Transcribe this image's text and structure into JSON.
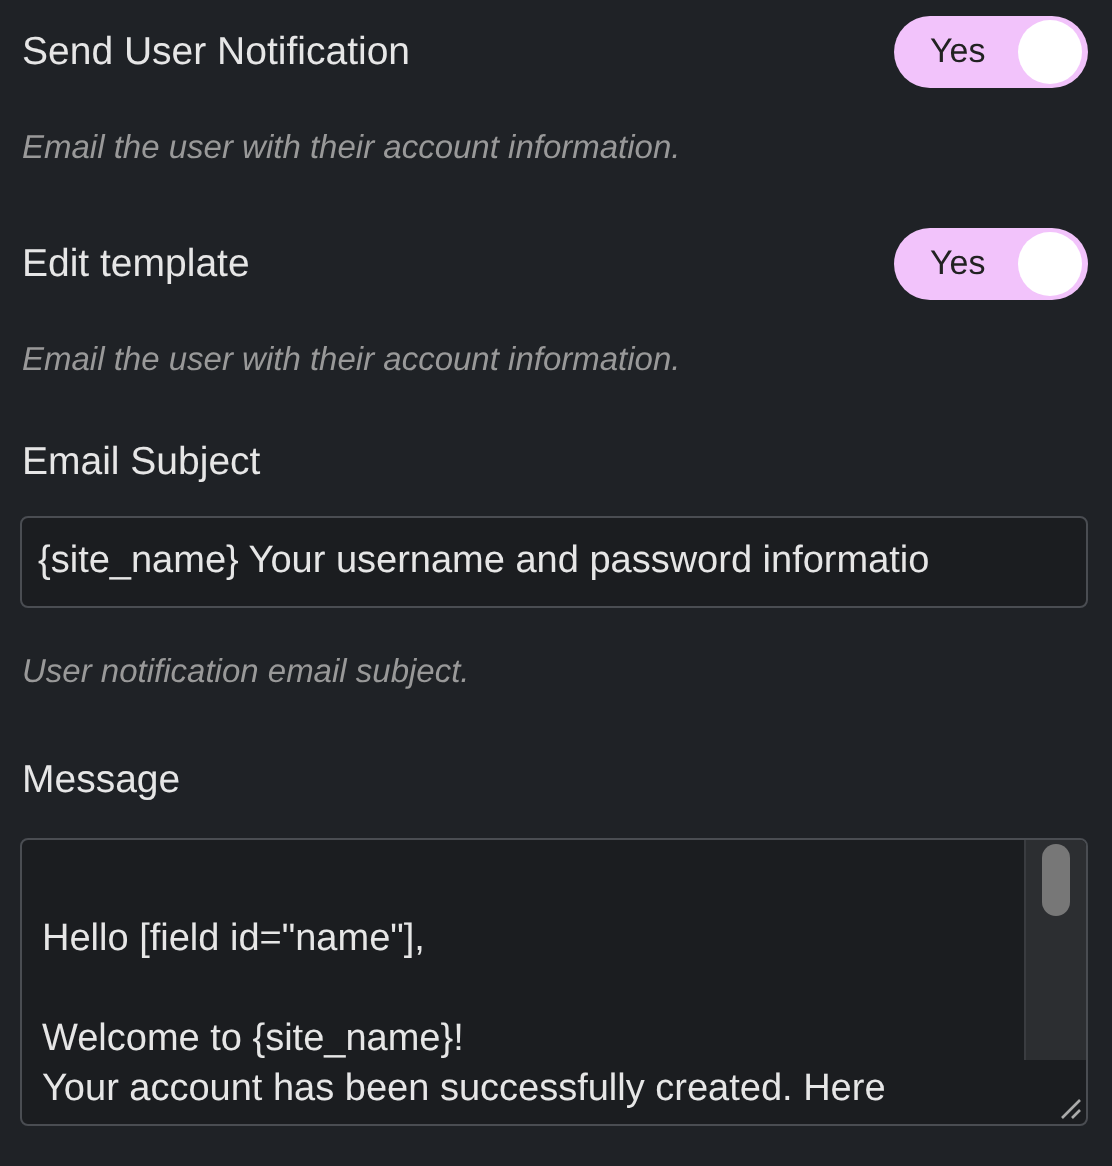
{
  "fields": [
    {
      "kind": "toggle",
      "label": "Send User Notification",
      "toggle": {
        "text": "Yes",
        "on": true
      },
      "description": "Email the user with their account information."
    },
    {
      "kind": "toggle",
      "label": "Edit template",
      "toggle": {
        "text": "Yes",
        "on": true
      },
      "description": "Email the user with their account information."
    },
    {
      "kind": "text",
      "label": "Email Subject",
      "value": "{site_name} Your username and password informatio",
      "description": "User notification email subject."
    },
    {
      "kind": "textarea",
      "label": "Message",
      "value": "\nHello [field id=\"name\"],\n\nWelcome to {site_name}!\nYour account has been successfully created. Here"
    }
  ]
}
